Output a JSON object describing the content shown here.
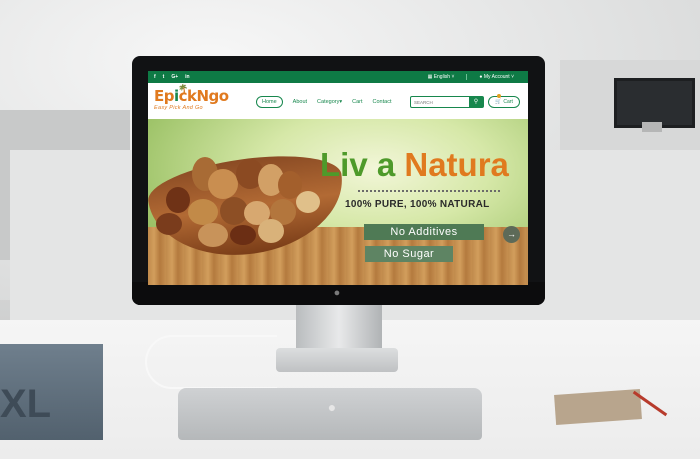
{
  "topbar": {
    "social": [
      "f",
      "t",
      "G+",
      "in"
    ],
    "language": "English",
    "account": "My Account"
  },
  "header": {
    "logo_text_1": "Ep",
    "logo_text_2": "i",
    "logo_text_3": "ckNgo",
    "logo_tagline": "Easy Pick And Go",
    "nav": {
      "home": "Home",
      "about": "About",
      "category": "Category",
      "cart": "Cart",
      "contact": "Contact"
    },
    "search": {
      "placeholder": "SEARCH"
    },
    "cart_button": "Cart"
  },
  "hero": {
    "headline_part1": "Liv a",
    "headline_part2": "Natura",
    "tagline": "100% PURE, 100% NATURAL",
    "badge1": "No Additives",
    "badge2": "No Sugar",
    "next_arrow": "→"
  },
  "background": {
    "book_label": "XL"
  },
  "colors": {
    "brand_green": "#17874d",
    "accent_orange": "#e07a1f"
  }
}
